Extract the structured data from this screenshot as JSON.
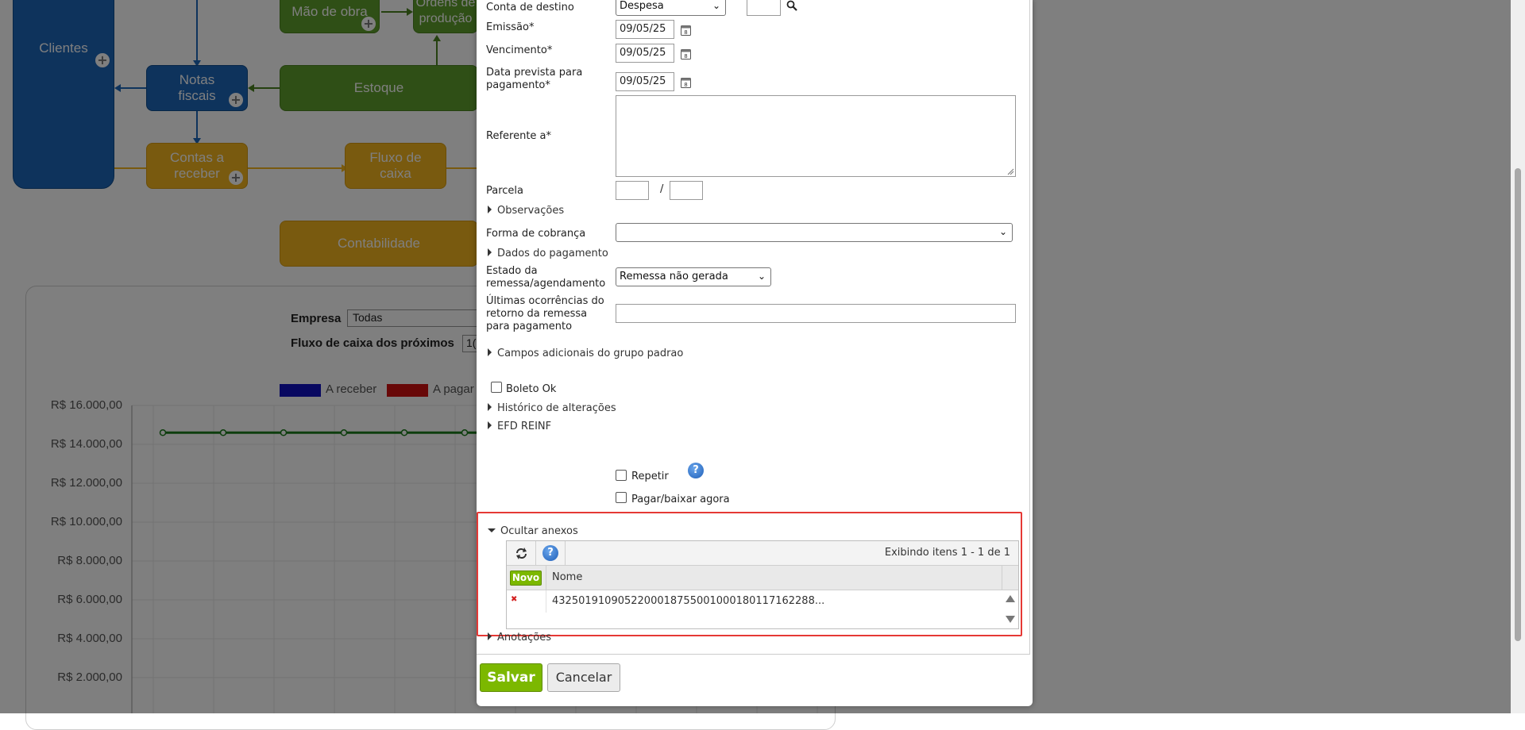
{
  "background": {
    "blocks": {
      "clientes": "Clientes",
      "mao_de_obra": "Mão de obra",
      "ordens_producao": "Ordens de produção",
      "notas_fiscais": "Notas fiscais",
      "estoque": "Estoque",
      "contas_a_receber": "Contas a receber",
      "fluxo_de_caixa": "Fluxo de caixa",
      "contabilidade": "Contabilidade"
    },
    "filters": {
      "empresa_label": "Empresa",
      "empresa_value": "Todas",
      "fluxo_label": "Fluxo de caixa dos próximos",
      "fluxo_value": "1("
    },
    "chart_data": {
      "type": "line",
      "legend": [
        "A receber",
        "A pagar"
      ],
      "y_ticks": [
        "R$ 16.000,00",
        "R$ 14.000,00",
        "R$ 12.000,00",
        "R$ 10.000,00",
        "R$ 8.000,00",
        "R$ 6.000,00",
        "R$ 4.000,00",
        "R$ 2.000,00"
      ],
      "ylim": [
        0,
        16000
      ],
      "series": [
        {
          "values": [
            14600,
            14600,
            14600,
            14600,
            14600,
            14600
          ]
        }
      ],
      "colors": {
        "a_receber": "#1010c0",
        "a_pagar": "#d01010",
        "line": "#1a7a1a"
      }
    }
  },
  "form": {
    "conta_destino": {
      "label": "Conta de destino",
      "value": "Despesa"
    },
    "emissao": {
      "label": "Emissão*",
      "value": "09/05/25"
    },
    "vencimento": {
      "label": "Vencimento*",
      "value": "09/05/25"
    },
    "data_prevista": {
      "label1": "Data prevista para",
      "label2": "pagamento*",
      "value": "09/05/25"
    },
    "referente": {
      "label": "Referente a*"
    },
    "parcela": {
      "label": "Parcela",
      "separator": "/"
    },
    "observacoes": "Observações",
    "forma_cobranca": {
      "label": "Forma de cobrança"
    },
    "dados_pagamento": "Dados do pagamento",
    "estado_remessa": {
      "label1": "Estado da",
      "label2": "remessa/agendamento",
      "value": "Remessa não gerada"
    },
    "ultimas_ocorrencias": {
      "label1": "Últimas ocorrências do",
      "label2": "retorno da remessa",
      "label3": "para pagamento"
    },
    "campos_adicionais": "Campos adicionais do grupo padrao",
    "boleto_ok": "Boleto Ok",
    "historico": "Histórico de alterações",
    "efd_reinf": "EFD REINF",
    "repetir": "Repetir",
    "pagar_baixar": "Pagar/baixar agora",
    "help_glyph": "?"
  },
  "attachments": {
    "toggle_label": "Ocultar anexos",
    "count_text": "Exibindo itens 1 - 1 de 1",
    "novo_label": "Novo",
    "col_nome": "Nome",
    "rows": [
      {
        "nome": "432501910905220001875500100018011716228​8..."
      }
    ],
    "delete_glyph": "✖"
  },
  "anotacoes": "Anotações",
  "buttons": {
    "salvar": "Salvar",
    "cancelar": "Cancelar"
  },
  "colors": {
    "accent_green": "#7cb800",
    "highlight_red": "#e53935",
    "blue": "#1d66b9",
    "green": "#5f9e2c",
    "orange": "#f2b41e"
  }
}
